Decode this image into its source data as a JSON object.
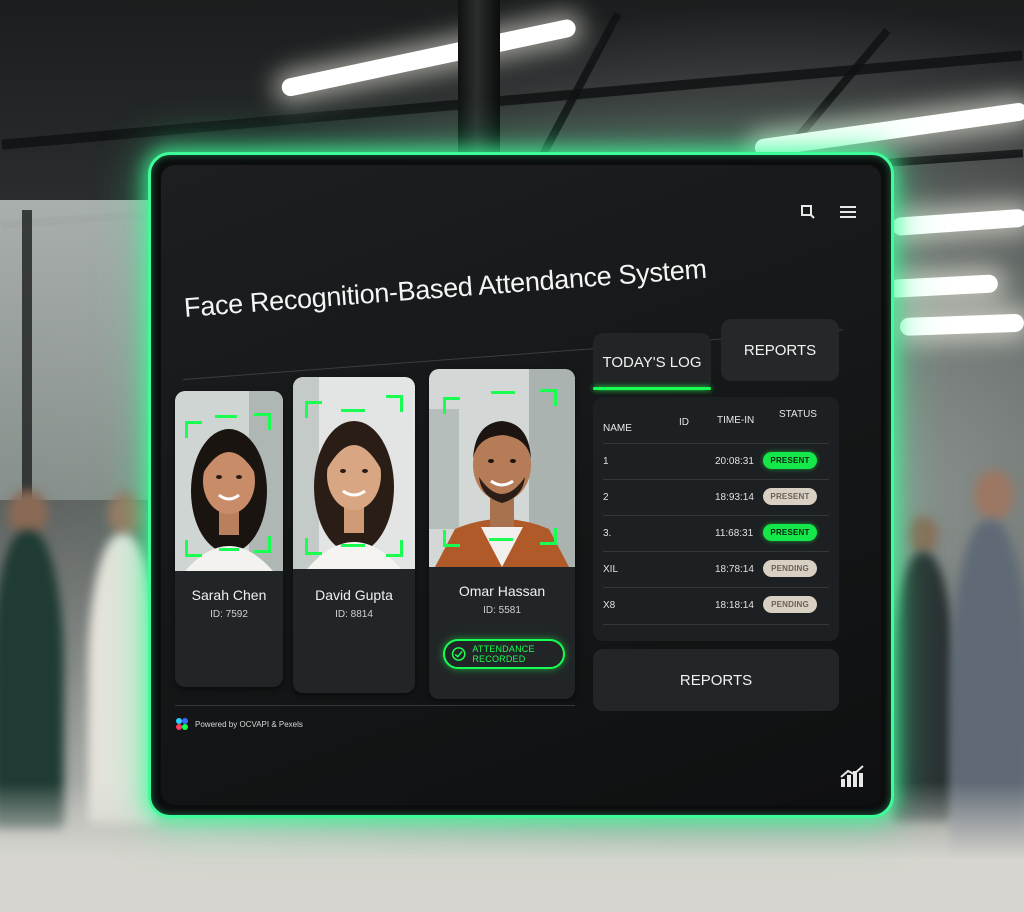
{
  "app": {
    "title": "Face Recognition-Based Attendance System",
    "footer_text": "Powered by OCVAPI & Pexels"
  },
  "icons": {
    "search": "search-icon",
    "menu": "menu-icon",
    "check": "check-circle-icon",
    "chart": "bar-chart-icon",
    "logo": "logo-icon"
  },
  "faces": [
    {
      "name": "Sarah Chen",
      "id": "ID: 7592"
    },
    {
      "name": "David Gupta",
      "id": "ID: 8814"
    },
    {
      "name": "Omar Hassan",
      "id": "ID: 5581",
      "badge": "ATTENDANCE RECORDED"
    }
  ],
  "tabs": {
    "todays_log": "TODAY'S LOG",
    "reports": "REPORTS"
  },
  "log": {
    "headers": [
      "NAME",
      "ID",
      "TIME-IN",
      "STATUS"
    ],
    "rows": [
      {
        "name": "1",
        "time": "20:08:31",
        "status": "PRESENT"
      },
      {
        "name": "2",
        "time": "18:93:14",
        "status": "PRESENT"
      },
      {
        "name": "3.",
        "time": "11:68:31",
        "status": "PRESENT"
      },
      {
        "name": "XIL",
        "time": "18:78:14",
        "status": "PENDING"
      },
      {
        "name": "X8",
        "time": "18:18:14",
        "status": "PENDING"
      }
    ]
  },
  "reports_button": "REPORTS",
  "colors": {
    "accent": "#18ff52",
    "frame_glow": "#3dfc9a",
    "pending": "#d8d0c2",
    "screen_bg": "#141617"
  }
}
